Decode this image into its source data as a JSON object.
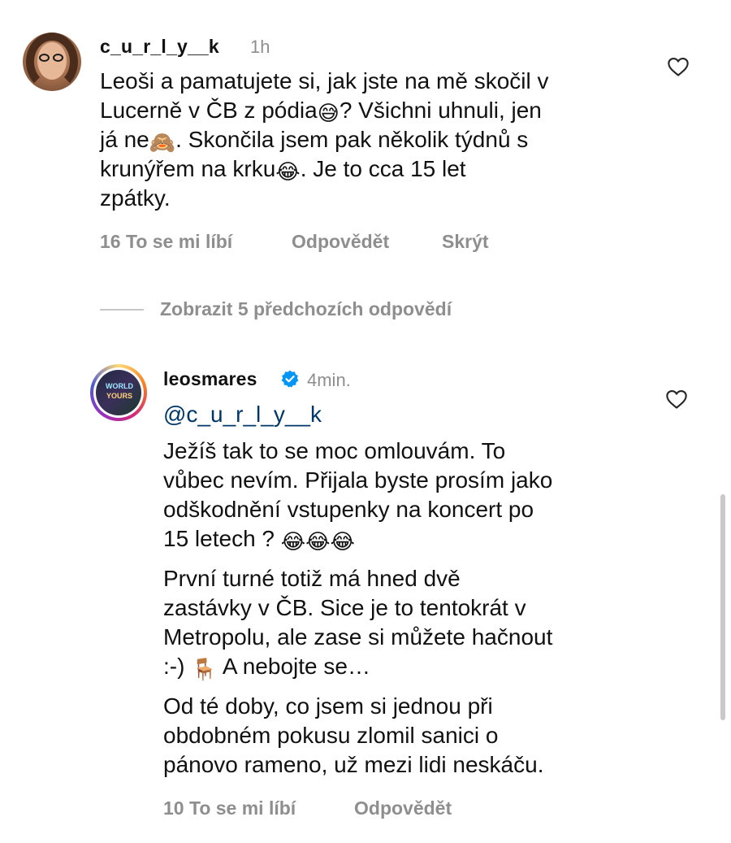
{
  "comments": [
    {
      "username": "c_u_r_l_y__k",
      "time": "1h",
      "lines": [
        [
          "Leoši a pamatujete si, jak jste na mě skočil v"
        ],
        [
          "Lucerně v ČB z pódia",
          "😅",
          "? Všichni uhnuli, jen"
        ],
        [
          "já ne",
          "🙈",
          ". Skončila jsem pak několik týdnů s"
        ],
        [
          "krunýřem na krku",
          "😂",
          ". Je to cca 15 let"
        ],
        [
          "zpátky."
        ]
      ],
      "likes_label": "16 To se mi líbí",
      "reply_label": "Odpovědět",
      "hide_label": "Skrýt"
    },
    {
      "username": "leosmares",
      "time": "4min.",
      "mention": "@c_u_r_l_y__k",
      "lines": [
        [
          "Ježíš tak to se moc omlouvám. To"
        ],
        [
          "vůbec nevím. Přijala byste prosím jako"
        ],
        [
          "odškodnění vstupenky na koncert po"
        ],
        [
          "15 letech ? ",
          "😂😂😂"
        ],
        [
          "První turné totiž má hned dvě"
        ],
        [
          "zastávky v ČB. Sice je to tentokrát v"
        ],
        [
          "Metropolu, ale zase si můžete hačnout"
        ],
        [
          ":-) ",
          "🪑",
          " A nebojte se…"
        ],
        [
          "Od té doby, co jsem si jednou při"
        ],
        [
          "obdobném pokusu zlomil sanici o"
        ],
        [
          "pánovo rameno, už mezi lidi neskáču."
        ]
      ],
      "likes_label": "10 To se mi líbí",
      "reply_label": "Odpovědět"
    }
  ],
  "view_previous_replies": "Zobrazit 5 předchozích odpovědí",
  "avatar2_text": [
    "WORLD",
    "YOURS"
  ],
  "colors": {
    "text": "#111111",
    "muted": "#8e8e8e",
    "mention": "#00376b",
    "verified": "#0095f6"
  }
}
